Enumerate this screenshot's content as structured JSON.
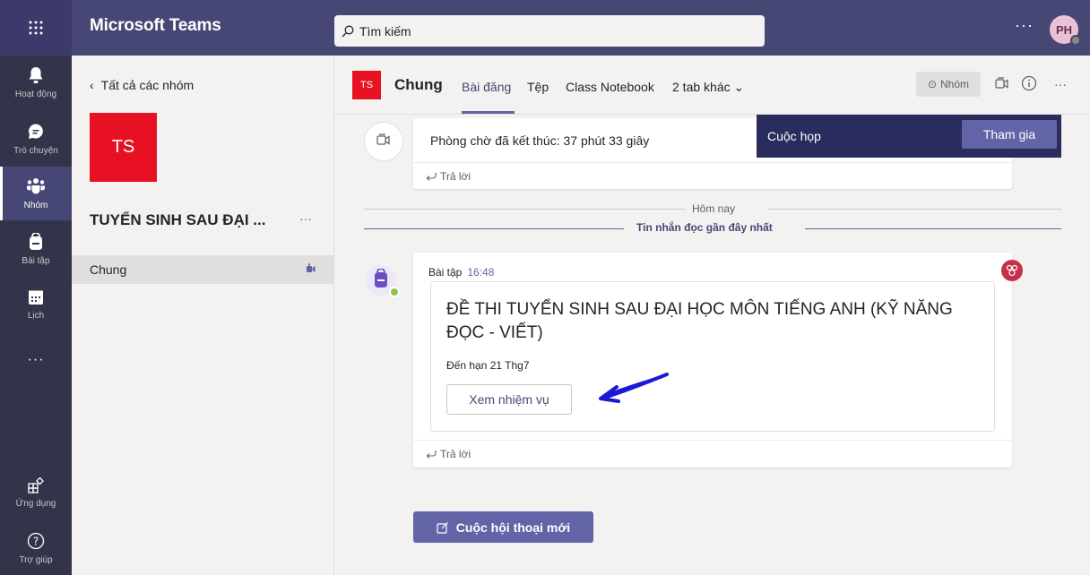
{
  "topbar": {
    "app_title": "Microsoft Teams",
    "search_placeholder": "Tìm kiếm",
    "more": "···",
    "avatar_initials": "PH"
  },
  "rail": {
    "items": [
      {
        "label": "Hoạt động",
        "icon": "bell-icon"
      },
      {
        "label": "Trò chuyện",
        "icon": "chat-icon"
      },
      {
        "label": "Nhóm",
        "icon": "teams-icon"
      },
      {
        "label": "Bài tập",
        "icon": "backpack-icon"
      },
      {
        "label": "Lịch",
        "icon": "calendar-icon"
      },
      {
        "label": "···",
        "icon": "more-icon"
      },
      {
        "label": "Ứng dụng",
        "icon": "apps-icon"
      },
      {
        "label": "Trợ giúp",
        "icon": "help-icon"
      }
    ],
    "active": "Nhóm"
  },
  "teams_panel": {
    "back_label": "Tất cả các nhóm",
    "team_logo_text": "TS",
    "team_name": "TUYỂN SINH SAU ĐẠI ...",
    "team_more": "···",
    "channel": "Chung"
  },
  "channel_header": {
    "logo_text": "TS",
    "title": "Chung",
    "tabs": [
      "Bài đăng",
      "Tệp",
      "Class Notebook",
      "2 tab khác ⌄"
    ],
    "team_button": "Nhóm",
    "more": "···"
  },
  "meeting_toast": {
    "label": "Cuộc họp",
    "join_button": "Tham gia"
  },
  "meeting_post": {
    "text": "Phòng chờ đã kết thúc: 37 phút 33 giây",
    "reply": "Trả lời"
  },
  "divider": {
    "today": "Hôm nay",
    "recent": "Tin nhắn đọc gần đây nhất"
  },
  "assignment_post": {
    "author": "Bài tập",
    "time": "16:48",
    "title": "ĐỀ THI TUYỂN SINH SAU ĐẠI HỌC MÔN TIẾNG ANH (KỸ NĂNG ĐỌC - VIẾT)",
    "due": "Đến hạn 21 Thg7",
    "view_button": "Xem nhiệm vụ",
    "reply": "Trả lời"
  },
  "new_conversation": "Cuộc hội thoại mới",
  "colors": {
    "brand": "#464775",
    "accent": "#6264a7",
    "rail": "#33344a",
    "team_logo": "#e81123",
    "annotation_arrow": "#1a1ad6"
  }
}
